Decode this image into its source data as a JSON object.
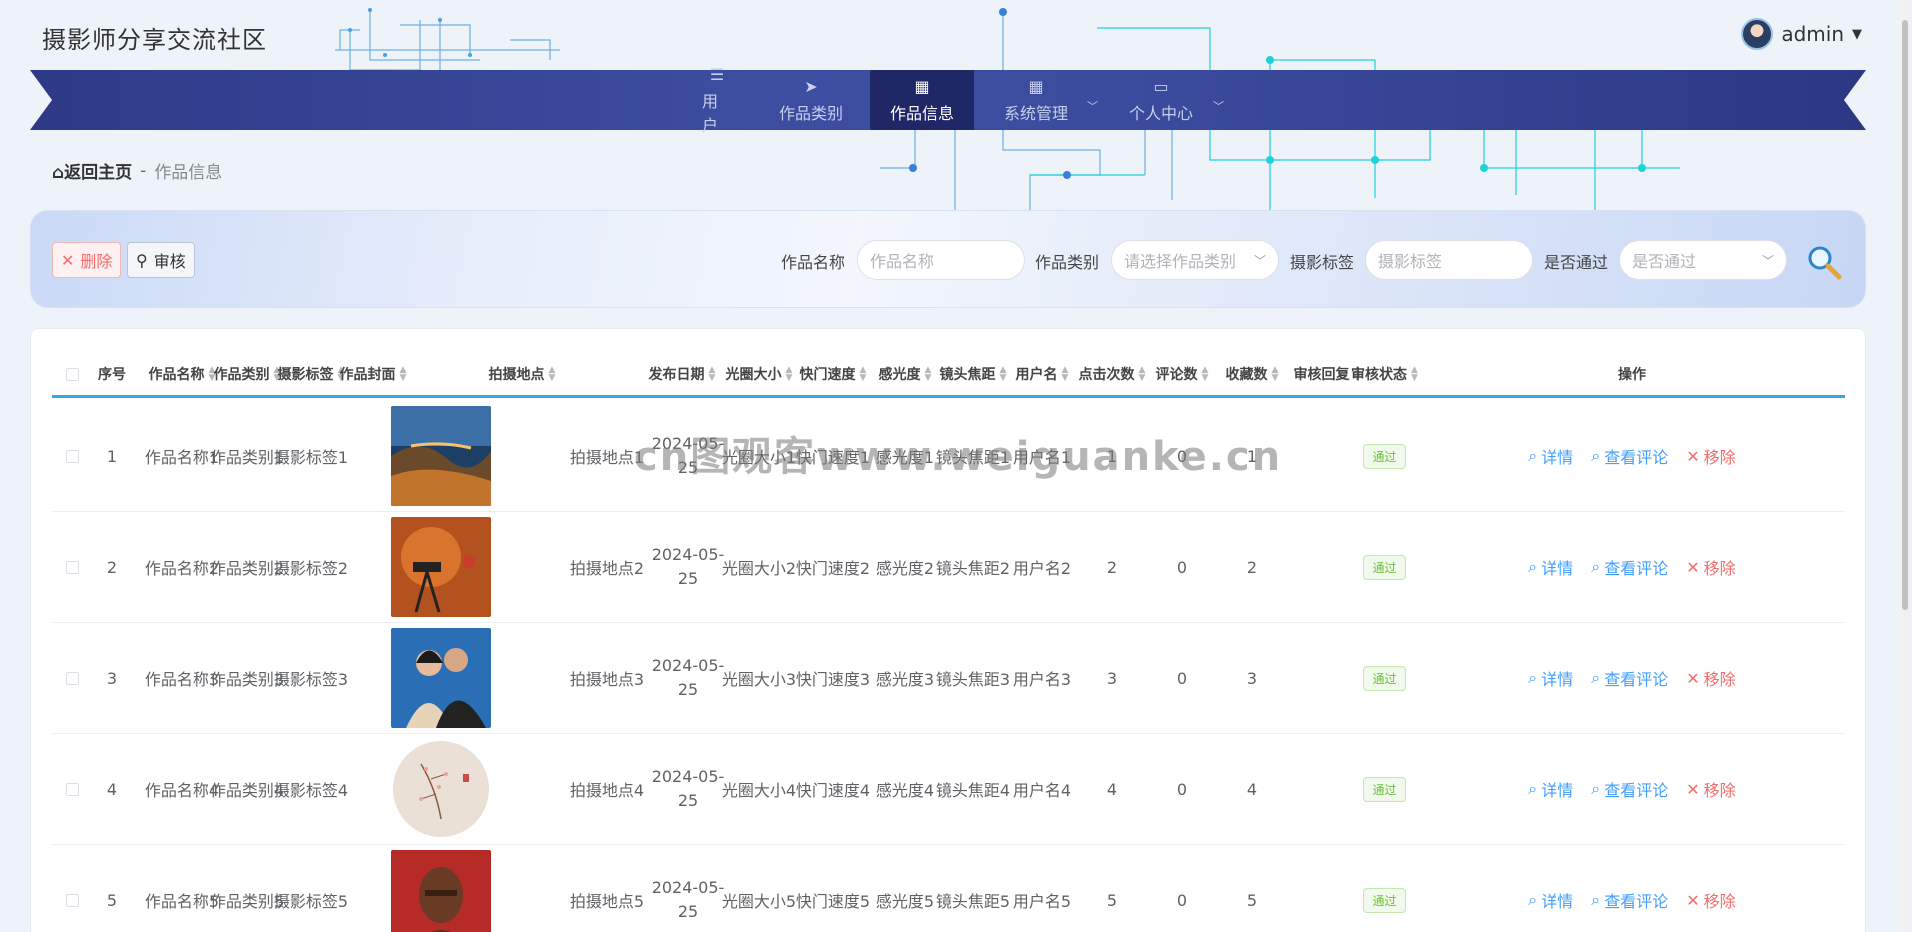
{
  "site": {
    "title": "摄影师分享交流社区"
  },
  "user": {
    "name": "admin"
  },
  "nav": [
    {
      "label": "用户",
      "icon": "list-icon",
      "active": false,
      "sub": false
    },
    {
      "label": "作品类别",
      "icon": "paper-plane-icon",
      "active": false,
      "sub": false
    },
    {
      "label": "作品信息",
      "icon": "grid-icon",
      "active": true,
      "sub": false
    },
    {
      "label": "系统管理",
      "icon": "grid-icon",
      "active": false,
      "sub": true
    },
    {
      "label": "个人中心",
      "icon": "wallet-icon",
      "active": false,
      "sub": true
    }
  ],
  "breadcrumb": {
    "home": "返回主页",
    "sep": "-",
    "current": "作品信息"
  },
  "toolbar": {
    "delete": "删除",
    "audit": "审核"
  },
  "search": {
    "name_label": "作品名称",
    "name_placeholder": "作品名称",
    "type_label": "作品类别",
    "type_placeholder": "请选择作品类别",
    "tag_label": "摄影标签",
    "tag_placeholder": "摄影标签",
    "pass_label": "是否通过",
    "pass_placeholder": "是否通过"
  },
  "columns": [
    "序号",
    "作品名称",
    "作品类别",
    "摄影标签",
    "作品封面",
    "拍摄地点",
    "发布日期",
    "光圈大小",
    "快门速度",
    "感光度",
    "镜头焦距",
    "用户名",
    "点击次数",
    "评论数",
    "收藏数",
    "审核回复",
    "审核状态",
    "操作"
  ],
  "actions": {
    "detail": "详情",
    "comments": "查看评论",
    "remove": "移除"
  },
  "rows": [
    {
      "idx": "1",
      "name": "作品名称1",
      "type": "作品类别1",
      "tag": "摄影标签1",
      "place": "拍摄地点1",
      "date": "2024-05-25",
      "aperture": "光圈大小1",
      "shutter": "快门速度1",
      "iso": "感光度1",
      "focal": "镜头焦距1",
      "user": "用户名1",
      "clicks": "1",
      "comments": "0",
      "favs": "1",
      "reply": "",
      "status": "通过"
    },
    {
      "idx": "2",
      "name": "作品名称2",
      "type": "作品类别2",
      "tag": "摄影标签2",
      "place": "拍摄地点2",
      "date": "2024-05-25",
      "aperture": "光圈大小2",
      "shutter": "快门速度2",
      "iso": "感光度2",
      "focal": "镜头焦距2",
      "user": "用户名2",
      "clicks": "2",
      "comments": "0",
      "favs": "2",
      "reply": "",
      "status": "通过"
    },
    {
      "idx": "3",
      "name": "作品名称3",
      "type": "作品类别3",
      "tag": "摄影标签3",
      "place": "拍摄地点3",
      "date": "2024-05-25",
      "aperture": "光圈大小3",
      "shutter": "快门速度3",
      "iso": "感光度3",
      "focal": "镜头焦距3",
      "user": "用户名3",
      "clicks": "3",
      "comments": "0",
      "favs": "3",
      "reply": "",
      "status": "通过"
    },
    {
      "idx": "4",
      "name": "作品名称4",
      "type": "作品类别4",
      "tag": "摄影标签4",
      "place": "拍摄地点4",
      "date": "2024-05-25",
      "aperture": "光圈大小4",
      "shutter": "快门速度4",
      "iso": "感光度4",
      "focal": "镜头焦距4",
      "user": "用户名4",
      "clicks": "4",
      "comments": "0",
      "favs": "4",
      "reply": "",
      "status": "通过"
    },
    {
      "idx": "5",
      "name": "作品名称5",
      "type": "作品类别5",
      "tag": "摄影标签5",
      "place": "拍摄地点5",
      "date": "2024-05-25",
      "aperture": "光圈大小5",
      "shutter": "快门速度5",
      "iso": "感光度5",
      "focal": "镜头焦距5",
      "user": "用户名5",
      "clicks": "5",
      "comments": "0",
      "favs": "5",
      "reply": "",
      "status": "通过"
    }
  ],
  "watermark": "cn图观客www.weiguanke.cn",
  "colors": {
    "nav": "#3b4b9d",
    "nav_active": "#1f2766",
    "accent": "#34a8e0",
    "danger": "#f56c6c",
    "success": "#67c23a"
  }
}
